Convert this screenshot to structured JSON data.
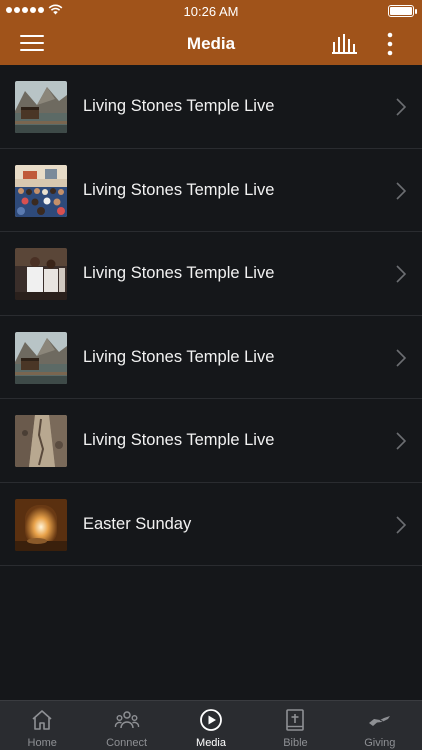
{
  "status_bar": {
    "time": "10:26 AM"
  },
  "nav": {
    "title": "Media"
  },
  "media_items": [
    {
      "title": "Living Stones Temple Live",
      "thumb": "lake-cabin"
    },
    {
      "title": "Living Stones Temple Live",
      "thumb": "congregation"
    },
    {
      "title": "Living Stones Temple Live",
      "thumb": "preacher"
    },
    {
      "title": "Living Stones Temple Live",
      "thumb": "lake-cabin"
    },
    {
      "title": "Living Stones Temple Live",
      "thumb": "rocky-path"
    },
    {
      "title": "Easter Sunday",
      "thumb": "empty-tomb"
    }
  ],
  "tabs": [
    {
      "label": "Home",
      "icon": "home-icon",
      "active": false
    },
    {
      "label": "Connect",
      "icon": "people-icon",
      "active": false
    },
    {
      "label": "Media",
      "icon": "play-icon",
      "active": true
    },
    {
      "label": "Bible",
      "icon": "bible-icon",
      "active": false
    },
    {
      "label": "Giving",
      "icon": "giving-hand-icon",
      "active": false
    }
  ],
  "colors": {
    "accent": "#a0531a",
    "background": "#15171a",
    "tab_bar": "#2a2c30"
  }
}
